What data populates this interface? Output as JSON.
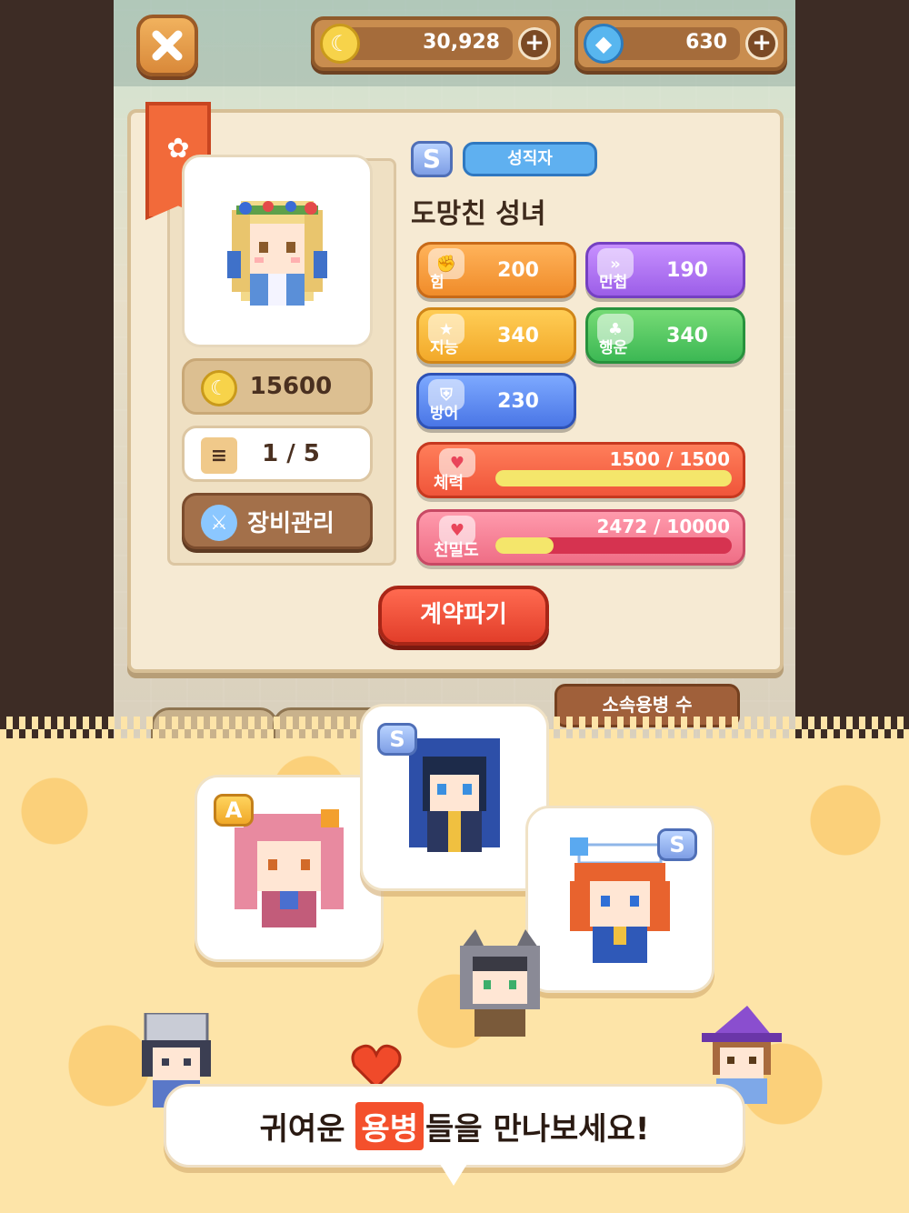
{
  "topbar": {
    "close_icon": "x-icon",
    "coins": "30,928",
    "gems": "630",
    "plus_symbol": "+"
  },
  "character": {
    "rank": "S",
    "job": "성직자",
    "name": "도망친 성녀",
    "price": "15600",
    "slots": "1 / 5",
    "equip_label": "장비관리"
  },
  "stats": [
    {
      "label": "힘",
      "value": "200",
      "color": "#f08c2a"
    },
    {
      "label": "민첩",
      "value": "190",
      "color": "#9c5ee8"
    },
    {
      "label": "지능",
      "value": "340",
      "color": "#f2a92a"
    },
    {
      "label": "행운",
      "value": "340",
      "color": "#3cb854"
    },
    {
      "label": "방어",
      "value": "230",
      "color": "#4a76e6"
    }
  ],
  "hp": {
    "label": "체력",
    "value": "1500 / 1500",
    "fill": 1.0
  },
  "affinity": {
    "label": "친밀도",
    "value": "2472 / 10000",
    "fill": 0.2472
  },
  "actions": {
    "break_contract": "계약파기",
    "member_count_label": "소속용병 수"
  },
  "promo": {
    "heroes": [
      {
        "grade": "A"
      },
      {
        "grade": "S"
      },
      {
        "grade": "S"
      }
    ],
    "banner_before": "귀여운",
    "banner_highlight": "용병",
    "banner_after": "들을 만나보세요!"
  },
  "colors": {
    "accent": "#f4502c",
    "parchment": "#f6ead3",
    "background": "#fde4a8"
  }
}
